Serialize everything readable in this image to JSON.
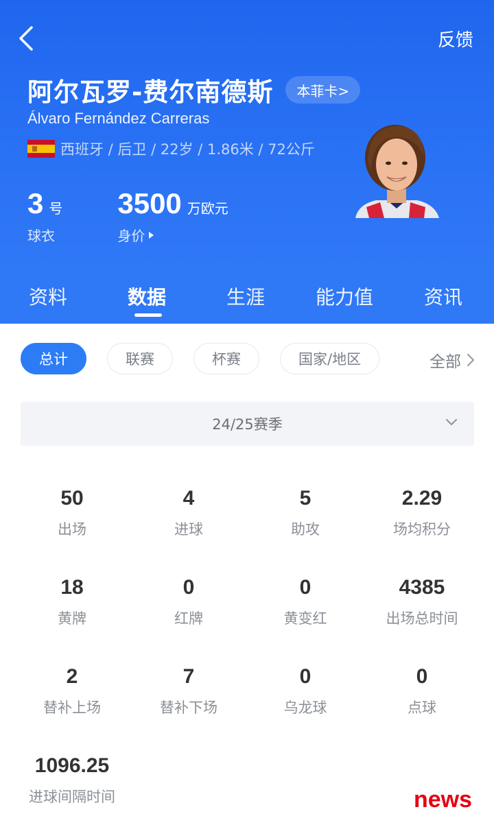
{
  "header": {
    "feedback_label": "反馈",
    "player_name": "阿尔瓦罗-费尔南德斯",
    "team_chip": "本菲卡>",
    "name_en": "Álvaro Fernández Carreras",
    "meta": "西班牙 / 后卫 / 22岁 / 1.86米 / 72公斤",
    "shirt_number": "3",
    "shirt_unit": "号",
    "shirt_label": "球衣",
    "market_value": "3500",
    "market_unit": "万欧元",
    "market_label": "身价"
  },
  "tabs": [
    {
      "label": "资料",
      "active": false
    },
    {
      "label": "数据",
      "active": true
    },
    {
      "label": "生涯",
      "active": false
    },
    {
      "label": "能力值",
      "active": false
    },
    {
      "label": "资讯",
      "active": false
    }
  ],
  "filters": {
    "chips": [
      {
        "label": "总计",
        "active": true
      },
      {
        "label": "联赛",
        "active": false
      },
      {
        "label": "杯赛",
        "active": false
      },
      {
        "label": "国家/地区",
        "active": false
      }
    ],
    "all_label": "全部"
  },
  "season": {
    "label": "24/25赛季"
  },
  "stats": [
    {
      "value": "50",
      "label": "出场"
    },
    {
      "value": "4",
      "label": "进球"
    },
    {
      "value": "5",
      "label": "助攻"
    },
    {
      "value": "2.29",
      "label": "场均积分"
    },
    {
      "value": "18",
      "label": "黄牌"
    },
    {
      "value": "0",
      "label": "红牌"
    },
    {
      "value": "0",
      "label": "黄变红"
    },
    {
      "value": "4385",
      "label": "出场总时间"
    },
    {
      "value": "2",
      "label": "替补上场"
    },
    {
      "value": "7",
      "label": "替补下场"
    },
    {
      "value": "0",
      "label": "乌龙球"
    },
    {
      "value": "0",
      "label": "点球"
    },
    {
      "value": "1096.25",
      "label": "进球间隔时间"
    }
  ],
  "watermark": "news",
  "colors": {
    "accent": "#2c7cf6",
    "header_bg": "#2a72f4",
    "watermark": "#e60012"
  },
  "icons": {
    "back": "chevron-left-icon",
    "flag": "spain-flag-icon",
    "season_toggle": "chevron-down-icon",
    "more": "chevron-right-icon"
  }
}
